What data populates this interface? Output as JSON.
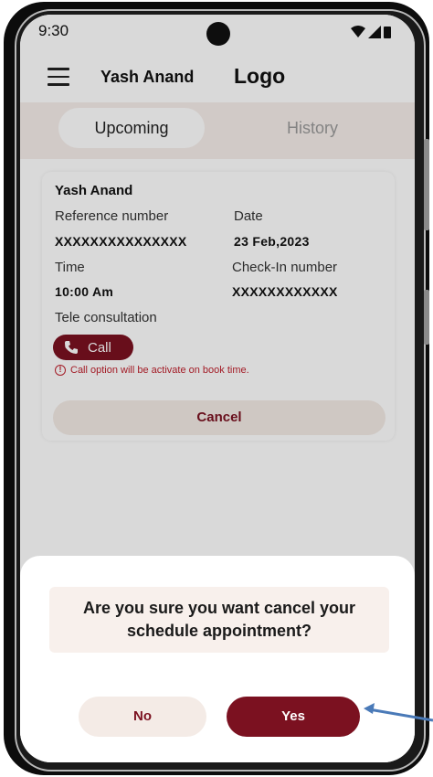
{
  "status_bar": {
    "time": "9:30"
  },
  "header": {
    "user_name": "Yash Anand",
    "logo": "Logo"
  },
  "tabs": [
    {
      "label": "Upcoming",
      "active": true
    },
    {
      "label": "History",
      "active": false
    }
  ],
  "appointment": {
    "patient_name": "Yash Anand",
    "reference_label": "Reference number",
    "reference_value": "XXXXXXXXXXXXXXX",
    "date_label": "Date",
    "date_value": "23 Feb,2023",
    "time_label": "Time",
    "time_value": "10:00 Am",
    "checkin_label": "Check-In number",
    "checkin_value": "XXXXXXXXXXXX",
    "consult_type": "Tele consultation",
    "call_label": "Call",
    "call_note": "Call option will be activate on book time.",
    "cancel_label": "Cancel"
  },
  "dialog": {
    "question": "Are you sure you want cancel your schedule appointment?",
    "no_label": "No",
    "yes_label": "Yes"
  },
  "colors": {
    "primary": "#7b1120",
    "light_bg": "#f4ebe6",
    "annotation_arrow": "#4a7ab8"
  }
}
